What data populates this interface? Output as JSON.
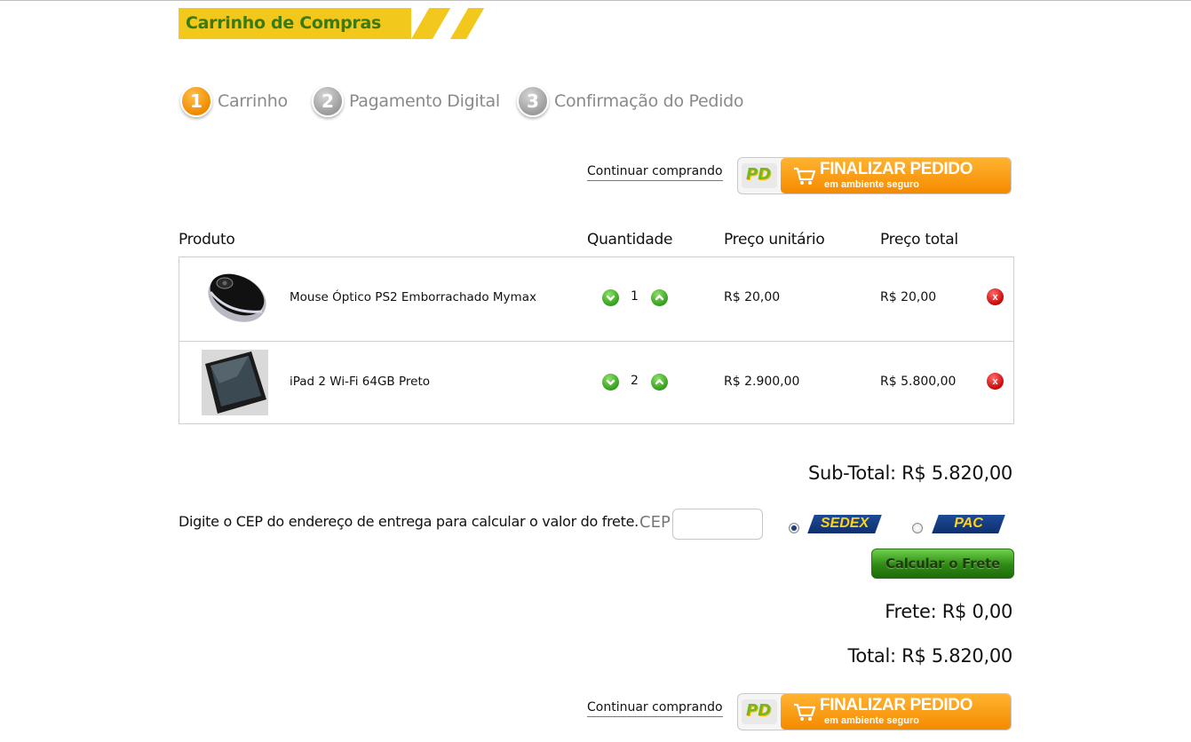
{
  "header": {
    "title": "Carrinho de Compras",
    "accent_color": "#f2c81d",
    "title_color": "#3a7a12"
  },
  "steps": [
    {
      "number": "1",
      "label": "Carrinho",
      "state": "active"
    },
    {
      "number": "2",
      "label": "Pagamento Digital",
      "state": "inactive"
    },
    {
      "number": "3",
      "label": "Confirmação do Pedido",
      "state": "inactive"
    }
  ],
  "actions": {
    "continue_label": "Continuar comprando",
    "finalize_title": "FINALIZAR PEDIDO",
    "finalize_subtitle": "em ambiente seguro",
    "pg_logo_text": "PD"
  },
  "table": {
    "headers": {
      "product": "Produto",
      "quantity": "Quantidade",
      "unit_price": "Preço unitário",
      "total_price": "Preço total"
    },
    "rows": [
      {
        "name": "Mouse Óptico PS2 Emborrachado Mymax",
        "quantity": "1",
        "unit_price": "R$ 20,00",
        "total_price": "R$ 20,00",
        "image": "mouse-image"
      },
      {
        "name": "iPad 2 Wi-Fi 64GB Preto",
        "quantity": "2",
        "unit_price": "R$ 2.900,00",
        "total_price": "R$ 5.800,00",
        "image": "tablet-image"
      }
    ]
  },
  "totals": {
    "subtotal": "Sub-Total: R$ 5.820,00",
    "freight": "Frete: R$ 0,00",
    "total": "Total: R$ 5.820,00"
  },
  "shipping": {
    "prompt": "Digite o CEP do endereço de entrega para calcular o valor do frete.",
    "cep_label": "CEP",
    "cep_value": "",
    "options": [
      {
        "label": "SEDEX",
        "selected": true
      },
      {
        "label": "PAC",
        "selected": false
      }
    ],
    "calc_button": "Calcular o Frete"
  },
  "icons": {
    "qty_down": "chevron-down-icon",
    "qty_up": "chevron-up-icon",
    "remove": "close-icon",
    "cart": "cart-icon"
  }
}
